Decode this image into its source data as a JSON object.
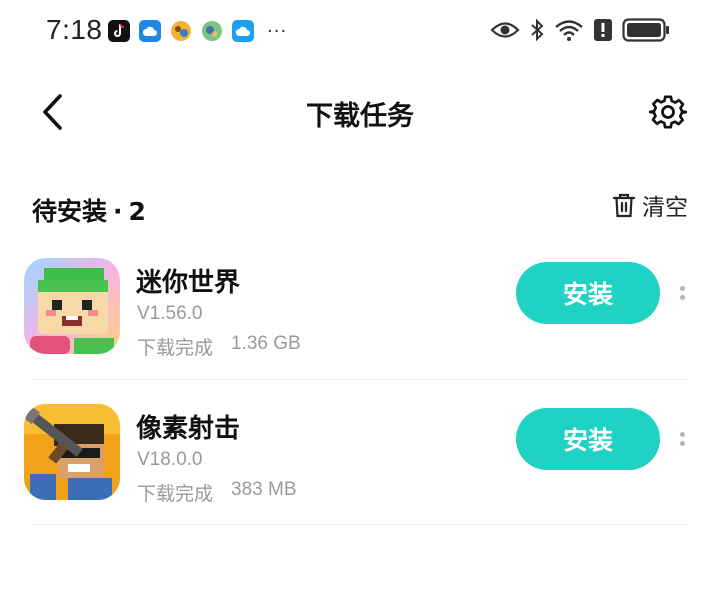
{
  "status_bar": {
    "time": "7:18",
    "more_indicator": "···",
    "notification_icons": [
      "tiktok-icon",
      "cloud-app-icon",
      "game-app-icon",
      "game-app-icon",
      "cloud-app-icon"
    ],
    "system_icons": [
      "eye-icon",
      "bluetooth-icon",
      "wifi-icon",
      "alert-icon",
      "battery-icon"
    ]
  },
  "header": {
    "title": "下载任务",
    "back_icon": "chevron-left-icon",
    "settings_icon": "gear-icon"
  },
  "section": {
    "title": "待安装",
    "separator": "·",
    "count": "2",
    "clear_label": "清空",
    "clear_icon": "trash-icon"
  },
  "tasks": [
    {
      "name": "迷你世界",
      "version": "V1.56.0",
      "status": "下载完成",
      "size": "1.36 GB",
      "action_label": "安装"
    },
    {
      "name": "像素射击",
      "version": "V18.0.0",
      "status": "下载完成",
      "size": "383 MB",
      "action_label": "安装"
    }
  ],
  "colors": {
    "accent": "#1fd2c3",
    "text_primary": "#111111",
    "text_secondary": "#9a9a9a",
    "divider": "#ececec"
  }
}
